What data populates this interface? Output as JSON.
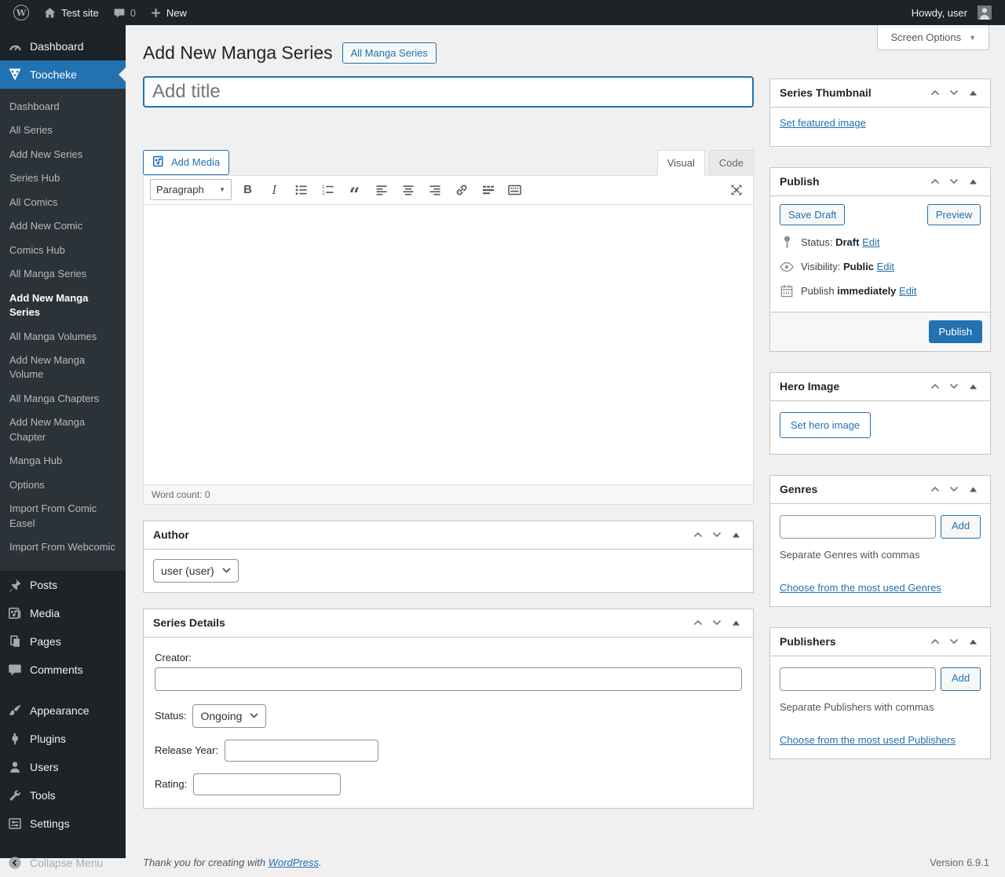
{
  "admin_bar": {
    "site_name": "Test site",
    "comments_count": "0",
    "new_label": "New",
    "howdy": "Howdy, user"
  },
  "screen_options": {
    "label": "Screen Options"
  },
  "page": {
    "title": "Add New Manga Series",
    "action": "All Manga Series"
  },
  "sidebar": {
    "dashboard": "Dashboard",
    "toocheke": "Toocheke",
    "submenu": [
      "Dashboard",
      "All Series",
      "Add New Series",
      "Series Hub",
      "All Comics",
      "Add New Comic",
      "Comics Hub",
      "All Manga Series",
      "Add New Manga Series",
      "All Manga Volumes",
      "Add New Manga Volume",
      "All Manga Chapters",
      "Add New Manga Chapter",
      "Manga Hub",
      "Options",
      "Import From Comic Easel",
      "Import From Webcomic"
    ],
    "menu": [
      "Posts",
      "Media",
      "Pages",
      "Comments",
      "Appearance",
      "Plugins",
      "Users",
      "Tools",
      "Settings"
    ],
    "collapse": "Collapse Menu"
  },
  "editor": {
    "title_placeholder": "Add title",
    "add_media": "Add Media",
    "visual_tab": "Visual",
    "code_tab": "Code",
    "paragraph": "Paragraph",
    "word_count_label": "Word count:",
    "word_count": "0"
  },
  "author_box": {
    "title": "Author",
    "selected": "user (user)"
  },
  "series_details": {
    "title": "Series Details",
    "creator_label": "Creator:",
    "status_label": "Status:",
    "status_value": "Ongoing",
    "release_year_label": "Release Year:",
    "rating_label": "Rating:"
  },
  "thumbnail_box": {
    "title": "Series Thumbnail",
    "set_link": "Set featured image"
  },
  "publish_box": {
    "title": "Publish",
    "save_draft": "Save Draft",
    "preview": "Preview",
    "status_label": "Status:",
    "status_value": "Draft",
    "visibility_label": "Visibility:",
    "visibility_value": "Public",
    "date_label": "Publish",
    "date_value": "immediately",
    "edit": "Edit",
    "publish_button": "Publish"
  },
  "hero_box": {
    "title": "Hero Image",
    "set_button": "Set hero image"
  },
  "genres_box": {
    "title": "Genres",
    "add_button": "Add",
    "help": "Separate Genres with commas",
    "choose_link": "Choose from the most used Genres"
  },
  "publishers_box": {
    "title": "Publishers",
    "add_button": "Add",
    "help": "Separate Publishers with commas",
    "choose_link": "Choose from the most used Publishers"
  },
  "footer": {
    "thanks_prefix": "Thank you for creating with",
    "wordpress_link": "WordPress",
    "suffix": ".",
    "version": "Version 6.9.1"
  },
  "icons": {
    "wordpress-logo": "W in circle",
    "home-icon": "house",
    "comments-bubble-icon": "speech bubble",
    "plus-icon": "plus",
    "avatar": "user silhouette",
    "dashboard-icon": "gauge",
    "toocheke-icon": "triangle mask face",
    "posts-icon": "pushpin",
    "media-icon": "camera with note",
    "pages-icon": "stacked pages",
    "appearance-icon": "paintbrush",
    "plugins-icon": "plug",
    "users-icon": "person",
    "tools-icon": "wrench",
    "settings-icon": "control panel sliders",
    "collapse-icon": "left arrow in circle",
    "status-pin-icon": "pin",
    "visibility-eye-icon": "eye",
    "calendar-icon": "calendar",
    "fullscreen-icon": "expand arrows",
    "chevron-up-icon": "chevron up",
    "chevron-down-icon": "chevron down",
    "toggle-triangle-icon": "triangle up"
  },
  "colors": {
    "accent_blue": "#2271b1",
    "admin_bar_bg": "#1d2327",
    "sidebar_bg": "#1d2327",
    "submenu_bg": "#2c3338",
    "page_bg": "#f0f0f1",
    "box_border": "#c3c4c7"
  }
}
